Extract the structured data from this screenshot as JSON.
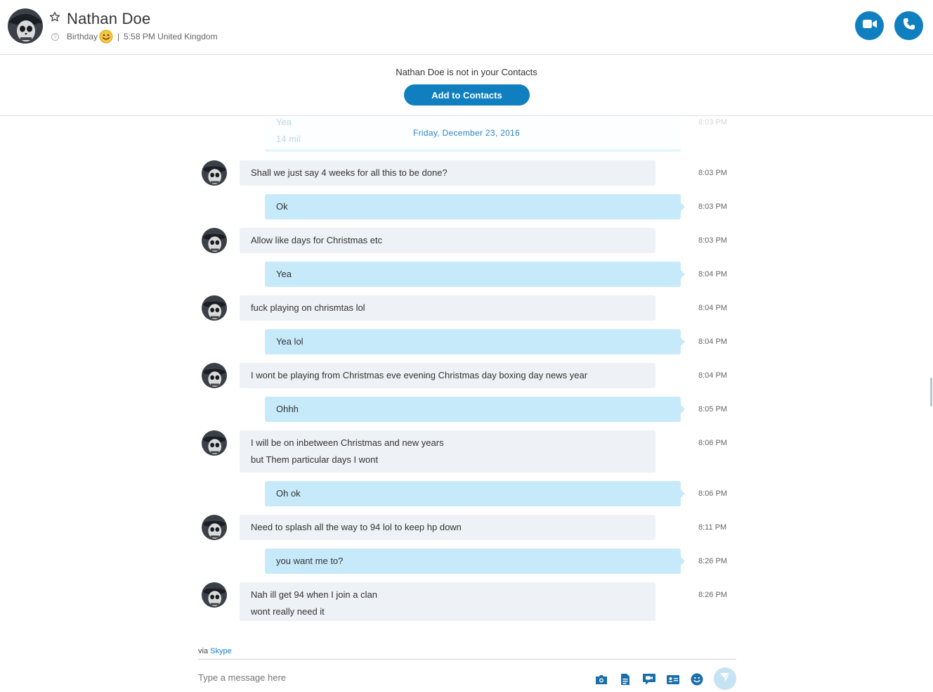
{
  "header": {
    "name": "Nathan Doe",
    "status": "Birthday",
    "separator": "|",
    "local_time": "5:58 PM United Kingdom"
  },
  "banner": {
    "text": "Nathan Doe is not in your Contacts",
    "add_button": "Add to Contacts"
  },
  "conversation": {
    "ghost_lines": [
      "Yea",
      "14 mil"
    ],
    "ghost_time": "8:03 PM",
    "date": "Friday, December 23, 2016",
    "messages": [
      {
        "dir": "in",
        "lines": [
          "Shall we just say 4 weeks for all this to be done?"
        ],
        "time": "8:03 PM"
      },
      {
        "dir": "out",
        "lines": [
          "Ok"
        ],
        "time": "8:03 PM"
      },
      {
        "dir": "in",
        "lines": [
          "Allow like days for Christmas etc"
        ],
        "time": "8:03 PM"
      },
      {
        "dir": "out",
        "lines": [
          "Yea"
        ],
        "time": "8:04 PM"
      },
      {
        "dir": "in",
        "lines": [
          "fuck playing on chrismtas lol"
        ],
        "time": "8:04 PM"
      },
      {
        "dir": "out",
        "lines": [
          "Yea lol"
        ],
        "time": "8:04 PM"
      },
      {
        "dir": "in",
        "lines": [
          "I wont be playing from Christmas eve evening Christmas day boxing day news year"
        ],
        "time": "8:04 PM"
      },
      {
        "dir": "out",
        "lines": [
          "Ohhh"
        ],
        "time": "8:05 PM"
      },
      {
        "dir": "in",
        "lines": [
          "I will be on inbetween Christmas and new years",
          "but Them particular days I wont"
        ],
        "time": "8:06 PM"
      },
      {
        "dir": "out",
        "lines": [
          "Oh ok"
        ],
        "time": "8:06 PM"
      },
      {
        "dir": "in",
        "lines": [
          "Need to splash all the way to 94 lol to keep hp down"
        ],
        "time": "8:11 PM"
      },
      {
        "dir": "out",
        "lines": [
          "you want me to?"
        ],
        "time": "8:26 PM"
      },
      {
        "dir": "in",
        "lines": [
          "Nah ill get 94 when I join a clan",
          "wont really need it"
        ],
        "time": "8:26 PM"
      }
    ]
  },
  "footer": {
    "via_prefix": "via",
    "via_link": "Skype",
    "compose_placeholder": "Type a message here",
    "tools": [
      "media-gallery-icon",
      "file-icon",
      "video-message-icon",
      "contact-card-icon",
      "emoticon-icon"
    ]
  },
  "colors": {
    "accent": "#0f7fc0",
    "incoming_bubble": "#eef1f5",
    "outgoing_bubble": "#c7eafb"
  }
}
